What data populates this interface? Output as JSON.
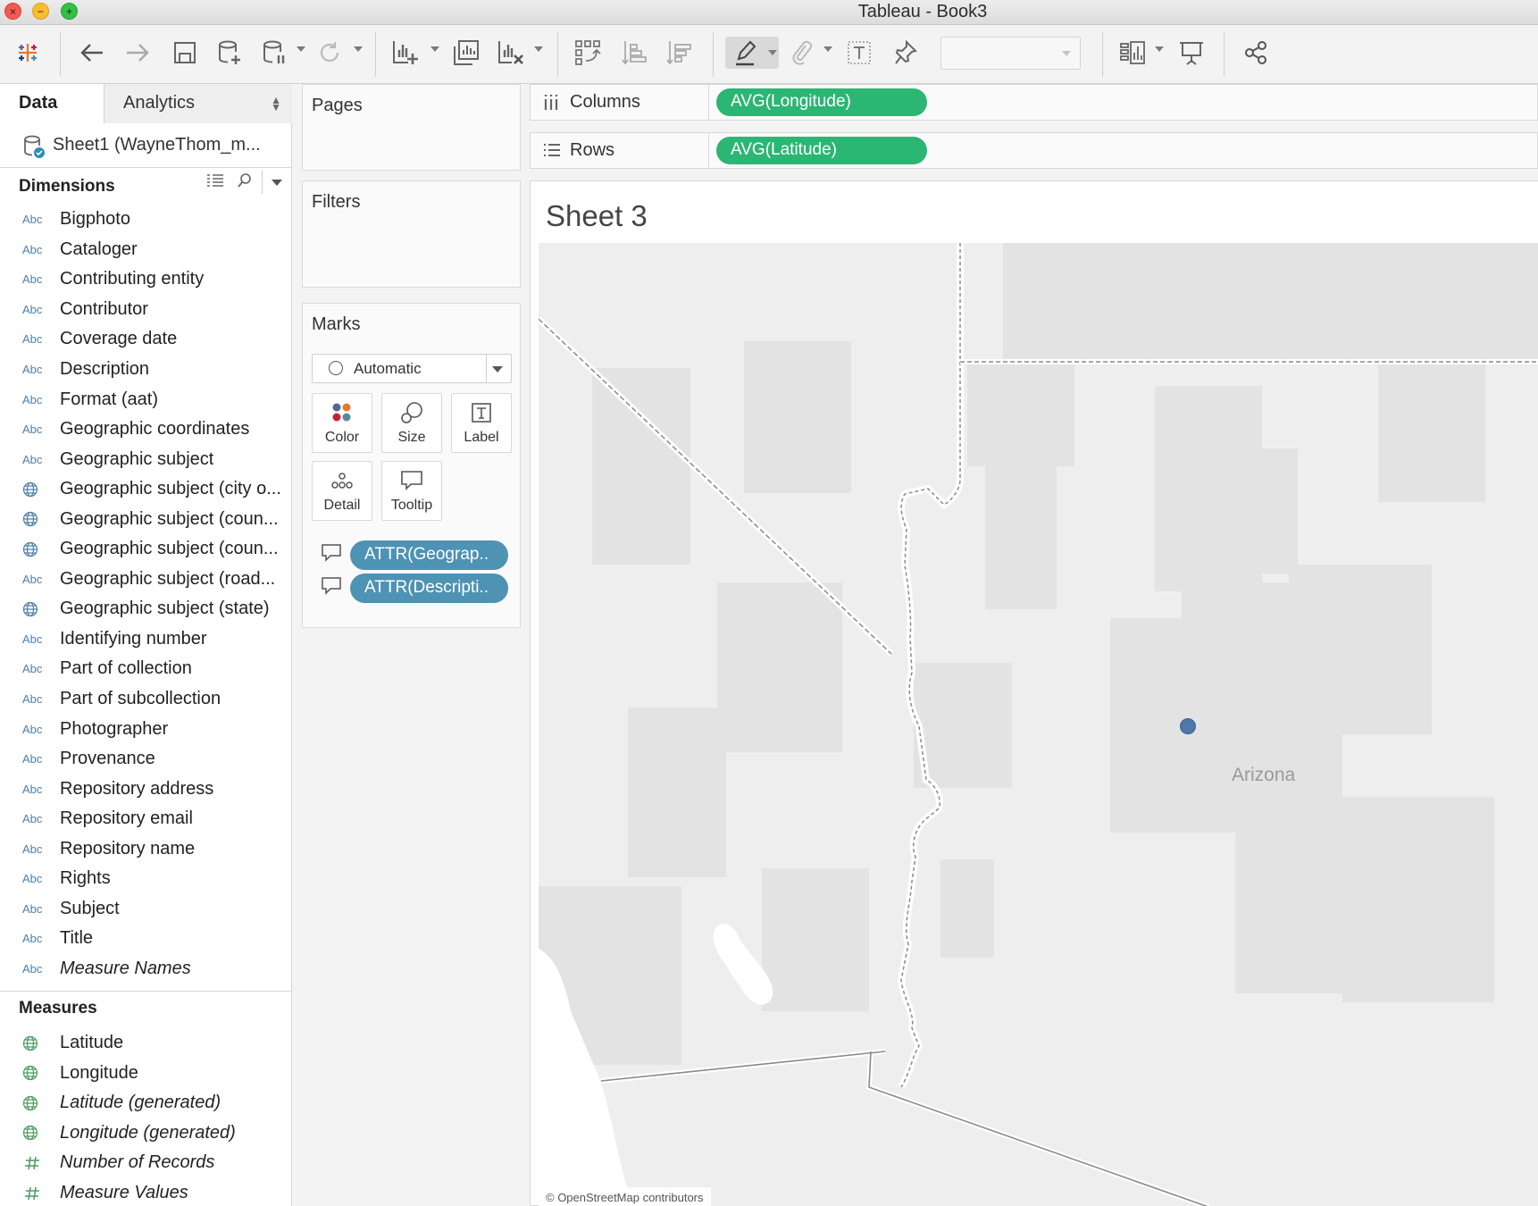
{
  "window": {
    "title": "Tableau - Book3"
  },
  "left_panel": {
    "tab_data": "Data",
    "tab_analytics": "Analytics",
    "datasource": "Sheet1 (WayneThom_m...",
    "dimensions_header": "Dimensions",
    "dimensions": [
      {
        "icon": "Abc",
        "name": "Bigphoto"
      },
      {
        "icon": "Abc",
        "name": "Cataloger"
      },
      {
        "icon": "Abc",
        "name": "Contributing entity"
      },
      {
        "icon": "Abc",
        "name": "Contributor"
      },
      {
        "icon": "Abc",
        "name": "Coverage date"
      },
      {
        "icon": "Abc",
        "name": "Description"
      },
      {
        "icon": "Abc",
        "name": "Format (aat)"
      },
      {
        "icon": "Abc",
        "name": "Geographic coordinates"
      },
      {
        "icon": "Abc",
        "name": "Geographic subject"
      },
      {
        "icon": "globe-icon",
        "name": "Geographic subject (city o..."
      },
      {
        "icon": "globe-icon",
        "name": "Geographic subject (coun..."
      },
      {
        "icon": "globe-icon",
        "name": "Geographic subject (coun..."
      },
      {
        "icon": "Abc",
        "name": "Geographic subject (road..."
      },
      {
        "icon": "globe-icon",
        "name": "Geographic subject (state)"
      },
      {
        "icon": "Abc",
        "name": "Identifying number"
      },
      {
        "icon": "Abc",
        "name": "Part of collection"
      },
      {
        "icon": "Abc",
        "name": "Part of subcollection"
      },
      {
        "icon": "Abc",
        "name": "Photographer"
      },
      {
        "icon": "Abc",
        "name": "Provenance"
      },
      {
        "icon": "Abc",
        "name": "Repository address"
      },
      {
        "icon": "Abc",
        "name": "Repository email"
      },
      {
        "icon": "Abc",
        "name": "Repository name"
      },
      {
        "icon": "Abc",
        "name": "Rights"
      },
      {
        "icon": "Abc",
        "name": "Subject"
      },
      {
        "icon": "Abc",
        "name": "Title"
      },
      {
        "icon": "Abc",
        "name": "Measure Names",
        "italic": true
      }
    ],
    "measures_header": "Measures",
    "measures": [
      {
        "icon": "globe-icon",
        "name": "Latitude"
      },
      {
        "icon": "globe-icon",
        "name": "Longitude"
      },
      {
        "icon": "globe-icon",
        "name": "Latitude (generated)",
        "italic": true
      },
      {
        "icon": "globe-icon",
        "name": "Longitude (generated)",
        "italic": true
      },
      {
        "icon": "hash-icon",
        "name": "Number of Records",
        "italic": true
      },
      {
        "icon": "hash-icon",
        "name": "Measure Values",
        "italic": true
      }
    ],
    "abc_text": "Abc"
  },
  "cards": {
    "pages": "Pages",
    "filters": "Filters",
    "marks": "Marks",
    "mark_type": "Automatic",
    "buttons": {
      "color": "Color",
      "size": "Size",
      "label": "Label",
      "detail": "Detail",
      "tooltip": "Tooltip"
    },
    "mark_pills": [
      "ATTR(Geograp..",
      "ATTR(Descripti.."
    ]
  },
  "shelves": {
    "columns_label": "Columns",
    "columns_pill": "AVG(Longitude)",
    "rows_label": "Rows",
    "rows_pill": "AVG(Latitude)"
  },
  "sheet": {
    "title": "Sheet 3",
    "map_label": "Arizona",
    "attribution": "© OpenStreetMap contributors",
    "point_color": "#4e79a7"
  },
  "colors": {
    "pill_green": "#2bb673",
    "pill_blue": "#4e92b4"
  }
}
